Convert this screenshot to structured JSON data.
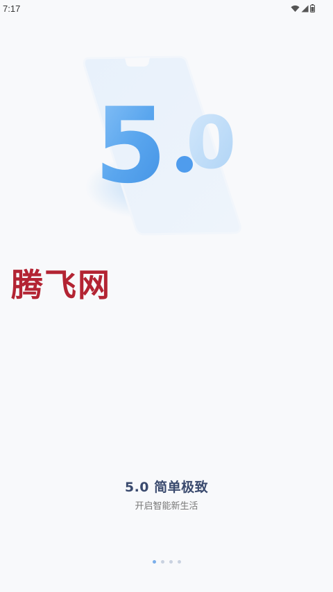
{
  "status_bar": {
    "time": "7:17",
    "icons": [
      "wifi-icon",
      "cell-signal-icon",
      "battery-icon"
    ]
  },
  "hero": {
    "version_main": "5",
    "version_dot": ".",
    "version_minor": "0",
    "accent_color": "#6fb0f2"
  },
  "watermark": {
    "text": "腾飞网",
    "color": "#b32433"
  },
  "onboarding": {
    "headline": "5.0 简单极致",
    "subline": "开启智能新生活"
  },
  "pager": {
    "page_count": 4,
    "active_index": 0
  }
}
